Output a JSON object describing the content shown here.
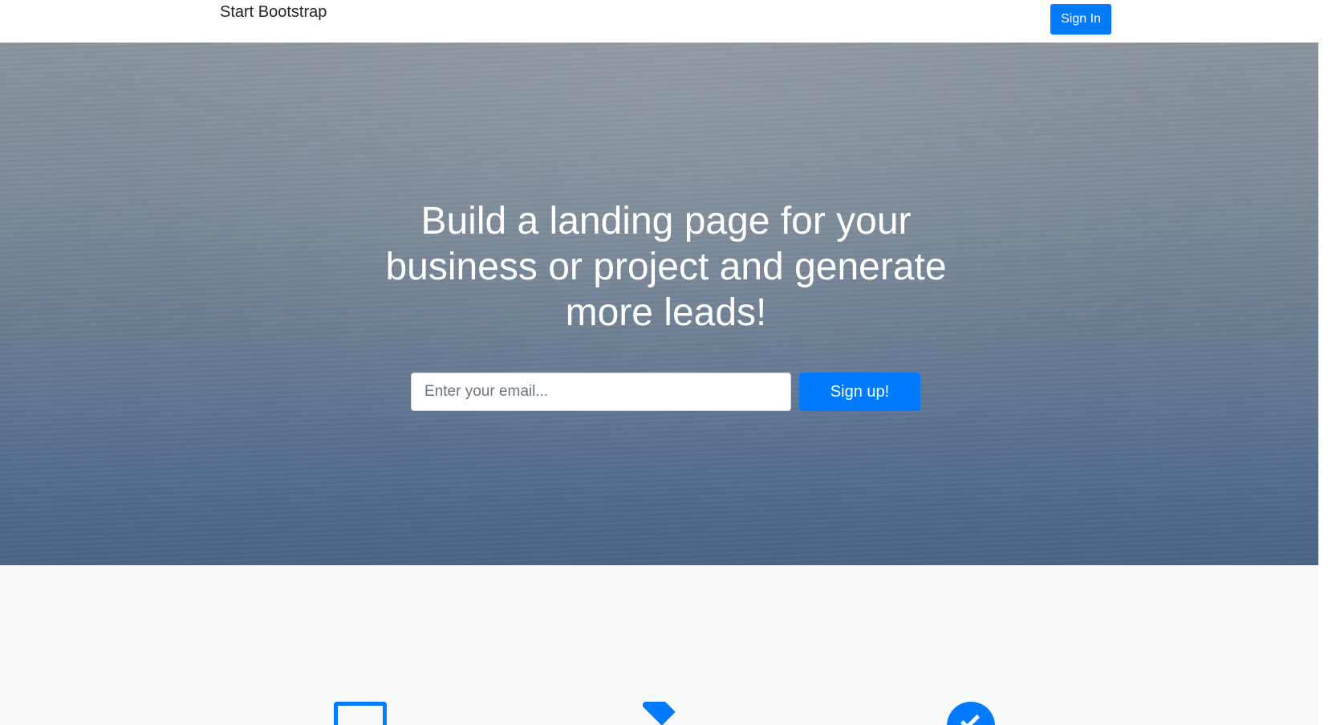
{
  "navbar": {
    "brand": "Start Bootstrap",
    "signin_label": "Sign In"
  },
  "hero": {
    "title": "Build a landing page for your business or project and generate more leads!",
    "email_placeholder": "Enter your email...",
    "signup_label": "Sign up!"
  },
  "features": {
    "icons": [
      "window-icon",
      "stack-icon",
      "check-circle-icon"
    ]
  },
  "colors": {
    "accent": "#007bff",
    "features_bg": "#f8f9fa"
  }
}
